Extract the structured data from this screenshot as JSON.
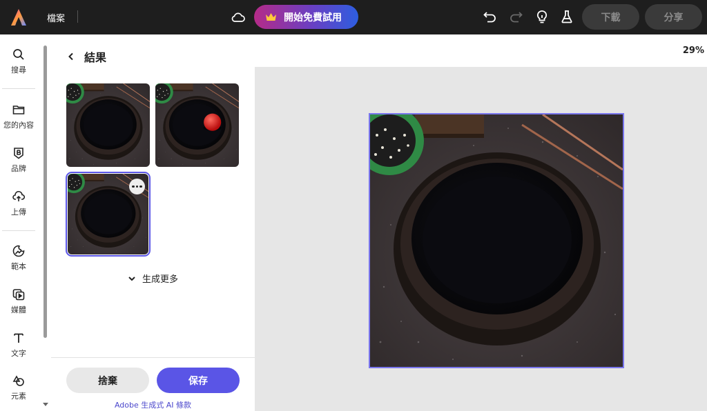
{
  "topbar": {
    "file_label": "檔案",
    "trial_label": "開始免費試用",
    "download_label": "下載",
    "share_label": "分享"
  },
  "rail": {
    "items": [
      {
        "label": "搜尋",
        "icon": "search-icon"
      },
      {
        "label": "您的內容",
        "icon": "folder-icon"
      },
      {
        "label": "品牌",
        "icon": "brand-icon"
      },
      {
        "label": "上傳",
        "icon": "upload-icon"
      },
      {
        "label": "範本",
        "icon": "template-icon"
      },
      {
        "label": "媒體",
        "icon": "media-icon"
      },
      {
        "label": "文字",
        "icon": "text-icon"
      },
      {
        "label": "元素",
        "icon": "elements-icon"
      }
    ]
  },
  "panel": {
    "title": "結果",
    "generate_more": "生成更多",
    "discard_label": "捨棄",
    "save_label": "保存",
    "terms_label": "Adobe 生成式 AI 條款"
  },
  "canvas": {
    "zoom": "29%"
  },
  "colors": {
    "accent": "#5a55e6",
    "topbar": "#1e1e1e"
  }
}
